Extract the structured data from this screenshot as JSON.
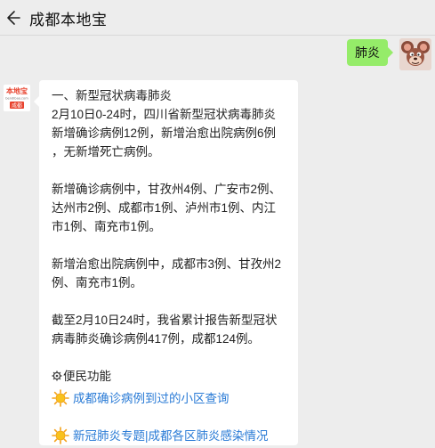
{
  "header": {
    "title": "成都本地宝"
  },
  "outgoing": {
    "text": "肺炎"
  },
  "bot_avatar": {
    "line1": "本地宝",
    "line2": "bendibao.com",
    "line3": "成都"
  },
  "message": {
    "heading": "一、新型冠状病毒肺炎",
    "p1": "2月10日0-24时，四川省新型冠状病毒肺炎\n新增确诊病例12例，新增治愈出院病例6例\n，无新增死亡病例。",
    "p2": "新增确诊病例中，甘孜州4例、广安市2例、\n达州市2例、成都市1例、泸州市1例、内江\n市1例、南充市1例。",
    "p3": "新增治愈出院病例中，成都市3例、甘孜州2\n例、南充市1例。",
    "p4": "截至2月10日24时，我省累计报告新型冠状\n病毒肺炎确诊病例417例，成都124例。",
    "service_title": "便民功能",
    "link1": "成都确诊病例到过的小区查询",
    "link2a": "新冠肺炎专题",
    "link2_sep": "|",
    "link2b": "成都各区肺炎感染情况"
  },
  "colors": {
    "link": "#2a7bd6",
    "outgoing_bubble": "#95ec69",
    "background": "#ededed"
  },
  "icons": [
    "back-arrow-icon",
    "gear-icon",
    "sun-icon"
  ]
}
